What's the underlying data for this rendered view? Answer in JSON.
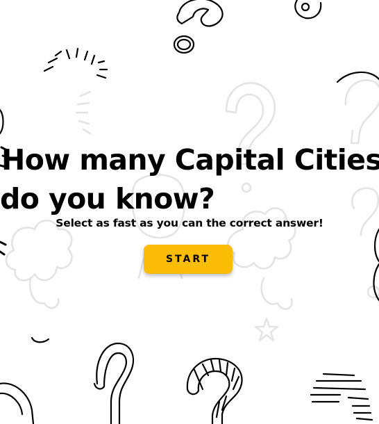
{
  "title": {
    "line1": "How many Capital Cities",
    "line2": "do you know?"
  },
  "subtitle": "Select as fast as you can the correct answer!",
  "start_button": {
    "label": "START"
  },
  "colors": {
    "background": "#ffffff",
    "text": "#000000",
    "button": "#fbbc05",
    "doodle_dark": "#000000",
    "doodle_light": "#e6e6e6"
  },
  "background_icons": [
    "question-mark-doodle-icon",
    "sun-rays-doodle-icon",
    "cloud-doodle-icon",
    "stripes-doodle-icon"
  ]
}
